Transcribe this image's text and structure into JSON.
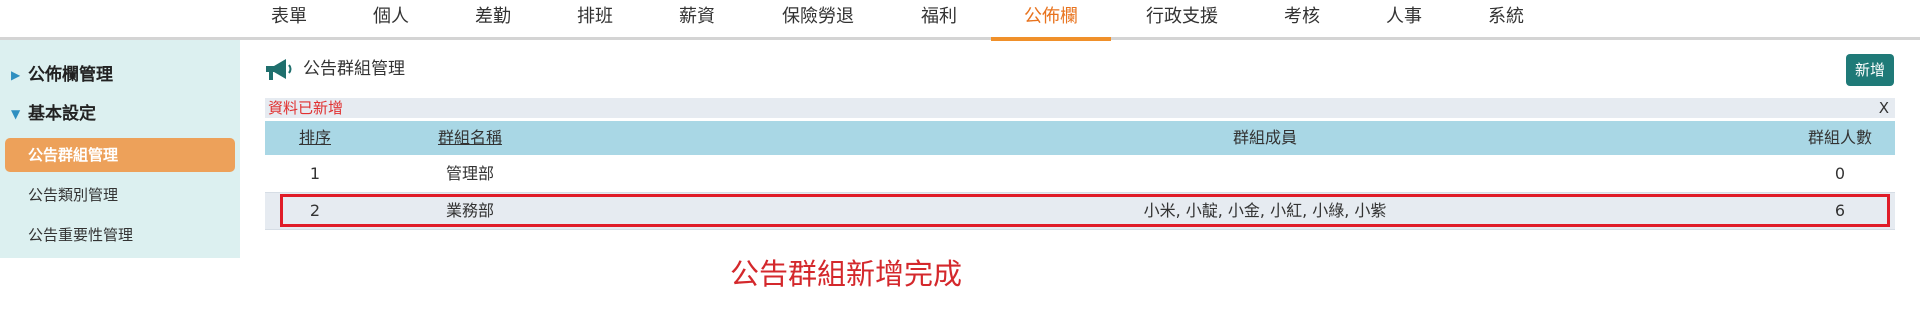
{
  "nav": {
    "items": [
      {
        "label": "表單",
        "active": false
      },
      {
        "label": "個人",
        "active": false
      },
      {
        "label": "差勤",
        "active": false
      },
      {
        "label": "排班",
        "active": false
      },
      {
        "label": "薪資",
        "active": false
      },
      {
        "label": "保險勞退",
        "active": false
      },
      {
        "label": "福利",
        "active": false
      },
      {
        "label": "公佈欄",
        "active": true
      },
      {
        "label": "行政支援",
        "active": false
      },
      {
        "label": "考核",
        "active": false
      },
      {
        "label": "人事",
        "active": false
      },
      {
        "label": "系統",
        "active": false
      }
    ]
  },
  "sidebar": {
    "groups": [
      {
        "label": "公佈欄管理",
        "expanded": false
      },
      {
        "label": "基本設定",
        "expanded": true
      }
    ],
    "subitems": [
      {
        "label": "公告群組管理",
        "active": true
      },
      {
        "label": "公告類別管理",
        "active": false
      },
      {
        "label": "公告重要性管理",
        "active": false
      }
    ]
  },
  "header": {
    "icon": "megaphone-icon",
    "title": "公告群組管理",
    "add_label": "新增"
  },
  "message": {
    "text": "資料已新增",
    "close_label": "X"
  },
  "table": {
    "columns": [
      "排序",
      "群組名稱",
      "群組成員",
      "群組人數"
    ],
    "rows": [
      {
        "order": "1",
        "name": "管理部",
        "members": "",
        "count": "0"
      },
      {
        "order": "2",
        "name": "業務部",
        "members": "小米, 小靛, 小金, 小紅, 小綠, 小紫",
        "count": "6"
      }
    ]
  },
  "annotation": {
    "text": "公告群組新增完成"
  },
  "colors": {
    "accent": "#e8731e",
    "active_sidebar": "#eda15a",
    "add_button": "#1f7a78",
    "table_header": "#a9d7e5",
    "alert_text": "#e13030",
    "highlight": "#e01c28"
  }
}
